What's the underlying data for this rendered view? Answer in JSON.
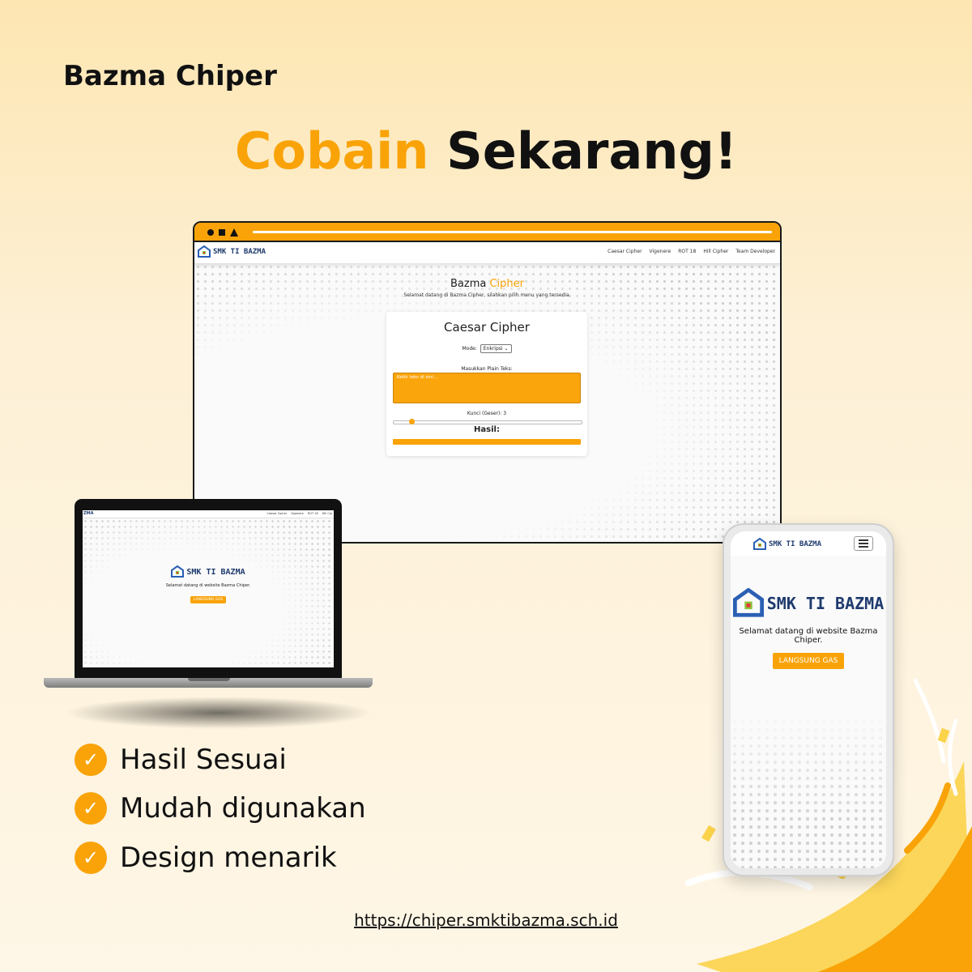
{
  "brand_title": "Bazma Chiper",
  "headline": {
    "accent": "Cobain",
    "rest": " Sekarang!"
  },
  "colors": {
    "accent": "#f9a308",
    "text": "#111111"
  },
  "monitor": {
    "logo_text": "SMK TI BAZMA",
    "nav_links": [
      "Caesar Cipher",
      "Vigenere",
      "ROT 18",
      "Hill Cipher",
      "Team Developer"
    ],
    "app_title": {
      "first": "Bazma ",
      "accent": "Cipher"
    },
    "app_subtitle": "Selamat datang di Bazma Cipher, silahkan pilih menu yang tersedia.",
    "card": {
      "title": "Caesar Cipher",
      "mode_label": "Mode:",
      "mode_value": "Enkripsi",
      "plain_label": "Masukkan Plain Teks:",
      "plain_placeholder": "Ketik teks di sini...",
      "key_label": "Kunci (Geser): 3",
      "key_value": 3,
      "hasil_label": "Hasil:"
    }
  },
  "laptop": {
    "logo_text": "SMK TI BAZMA",
    "nav_logo": "ZMA",
    "nav_links": [
      "Caesar Cipher",
      "Vigenere",
      "ROT 18",
      "Hill Cip"
    ],
    "welcome": "Selamat datang di website Bazma Chiper.",
    "cta": "LANGSUNG GAS"
  },
  "phone": {
    "nav_logo": "SMK TI BAZMA",
    "logo_text": "SMK TI BAZMA",
    "welcome": "Selamat datang di website Bazma Chiper.",
    "cta": "LANGSUNG GAS"
  },
  "features": [
    "Hasil Sesuai",
    "Mudah digunakan",
    "Design menarik"
  ],
  "url": "https://chiper.smktibazma.sch.id"
}
